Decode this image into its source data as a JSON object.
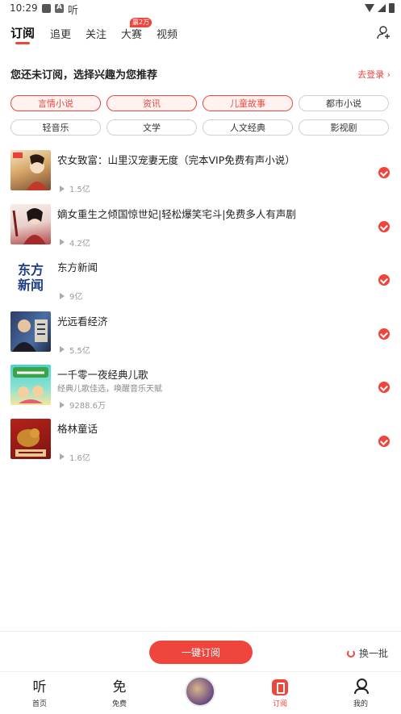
{
  "status_bar": {
    "time": "10:29",
    "app_glyph": "听"
  },
  "tabs": [
    {
      "label": "订阅"
    },
    {
      "label": "追更"
    },
    {
      "label": "关注"
    },
    {
      "label": "大赛"
    },
    {
      "label": "视频"
    }
  ],
  "hot_badge": "赢2万",
  "section": {
    "title": "您还未订阅，选择兴趣为您推荐",
    "login_link": "去登录 ›"
  },
  "chips": [
    {
      "label": "言情小说",
      "selected": true
    },
    {
      "label": "资讯",
      "selected": true
    },
    {
      "label": "儿童故事",
      "selected": true
    },
    {
      "label": "都市小说",
      "selected": false
    },
    {
      "label": "轻音乐",
      "selected": false
    },
    {
      "label": "文学",
      "selected": false
    },
    {
      "label": "人文经典",
      "selected": false
    },
    {
      "label": "影视剧",
      "selected": false
    }
  ],
  "items": [
    {
      "title": "农女致富：山里汉宠妻无度（完本VIP免费有声小说）",
      "subtitle": "",
      "plays": "1.5亿"
    },
    {
      "title": "嫡女重生之倾国惊世妃|轻松爆笑宅斗|免费多人有声剧",
      "subtitle": "",
      "plays": "4.2亿"
    },
    {
      "title": "东方新闻",
      "subtitle": "",
      "plays": "9亿",
      "cover_text": "东方新闻"
    },
    {
      "title": "光远看经济",
      "subtitle": "",
      "plays": "5.5亿"
    },
    {
      "title": "一千零一夜经典儿歌",
      "subtitle": "经典儿歌佳选，唤醒音乐天赋",
      "plays": "9288.6万"
    },
    {
      "title": "格林童话",
      "subtitle": "",
      "plays": "1.6亿"
    }
  ],
  "action_bar": {
    "subscribe_label": "一键订阅",
    "refresh_label": "换一批"
  },
  "bottom_nav": [
    {
      "label": "首页",
      "glyph": "听"
    },
    {
      "label": "免费",
      "glyph": "免"
    },
    {
      "label": "订阅",
      "glyph": ""
    },
    {
      "label": "我的",
      "glyph": ""
    }
  ],
  "colors": {
    "accent": "#f0453d"
  }
}
